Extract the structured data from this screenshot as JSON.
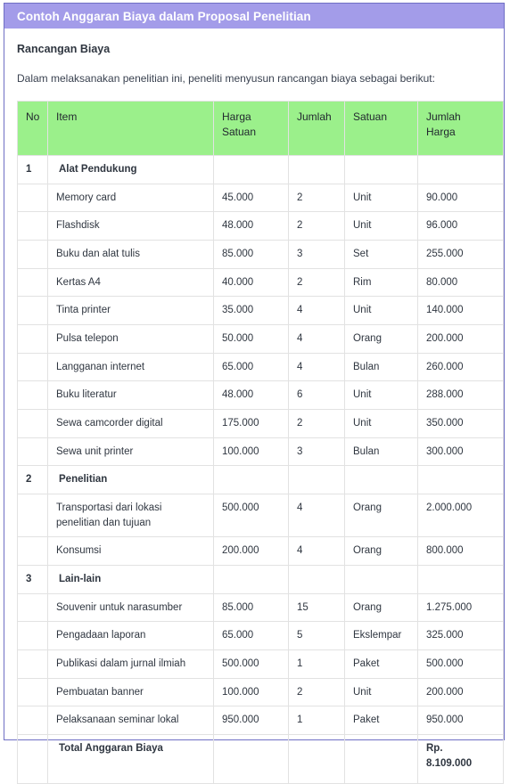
{
  "header": {
    "title": "Contoh Anggaran Biaya dalam Proposal Penelitian"
  },
  "document": {
    "section_heading": "Rancangan Biaya",
    "intro_paragraph": "Dalam melaksanakan penelitian ini, peneliti menyusun rancangan biaya sebagai berikut:"
  },
  "table": {
    "columns": [
      "No",
      "Item",
      "Harga Satuan",
      "Jumlah",
      "Satuan",
      "Jumlah Harga"
    ],
    "rows": [
      {
        "type": "group",
        "no": "1",
        "item": "Alat Pendukung",
        "harga": "",
        "jumlah": "",
        "satuan": "",
        "total": ""
      },
      {
        "type": "item",
        "no": "",
        "item": "Memory card",
        "harga": "45.000",
        "jumlah": "2",
        "satuan": "Unit",
        "total": "90.000"
      },
      {
        "type": "item",
        "no": "",
        "item": "Flashdisk",
        "harga": "48.000",
        "jumlah": "2",
        "satuan": "Unit",
        "total": "96.000"
      },
      {
        "type": "item",
        "no": "",
        "item": "Buku dan alat tulis",
        "harga": "85.000",
        "jumlah": "3",
        "satuan": "Set",
        "total": "255.000"
      },
      {
        "type": "item",
        "no": "",
        "item": "Kertas A4",
        "harga": "40.000",
        "jumlah": "2",
        "satuan": "Rim",
        "total": "80.000"
      },
      {
        "type": "item",
        "no": "",
        "item": "Tinta printer",
        "harga": "35.000",
        "jumlah": "4",
        "satuan": "Unit",
        "total": "140.000"
      },
      {
        "type": "item",
        "no": "",
        "item": "Pulsa telepon",
        "harga": "50.000",
        "jumlah": "4",
        "satuan": "Orang",
        "total": "200.000"
      },
      {
        "type": "item",
        "no": "",
        "item": "Langganan internet",
        "harga": "65.000",
        "jumlah": "4",
        "satuan": "Bulan",
        "total": "260.000"
      },
      {
        "type": "item",
        "no": "",
        "item": "Buku literatur",
        "harga": "48.000",
        "jumlah": "6",
        "satuan": "Unit",
        "total": "288.000"
      },
      {
        "type": "item",
        "no": "",
        "item": "Sewa camcorder digital",
        "harga": "175.000",
        "jumlah": "2",
        "satuan": "Unit",
        "total": "350.000"
      },
      {
        "type": "item",
        "no": "",
        "item": "Sewa unit printer",
        "harga": "100.000",
        "jumlah": "3",
        "satuan": "Bulan",
        "total": "300.000"
      },
      {
        "type": "group",
        "no": "2",
        "item": "Penelitian",
        "harga": "",
        "jumlah": "",
        "satuan": "",
        "total": ""
      },
      {
        "type": "item",
        "no": "",
        "item": "Transportasi dari lokasi penelitian dan tujuan",
        "harga": "500.000",
        "jumlah": "4",
        "satuan": "Orang",
        "total": "2.000.000"
      },
      {
        "type": "item",
        "no": "",
        "item": "Konsumsi",
        "harga": "200.000",
        "jumlah": "4",
        "satuan": "Orang",
        "total": "800.000"
      },
      {
        "type": "group",
        "no": "3",
        "item": "Lain-lain",
        "harga": "",
        "jumlah": "",
        "satuan": "",
        "total": ""
      },
      {
        "type": "item",
        "no": "",
        "item": "Souvenir untuk narasumber",
        "harga": "85.000",
        "jumlah": "15",
        "satuan": "Orang",
        "total": "1.275.000"
      },
      {
        "type": "item",
        "no": "",
        "item": "Pengadaan laporan",
        "harga": "65.000",
        "jumlah": "5",
        "satuan": "Ekslempar",
        "total": "325.000"
      },
      {
        "type": "item",
        "no": "",
        "item": "Publikasi dalam jurnal ilmiah",
        "harga": "500.000",
        "jumlah": "1",
        "satuan": "Paket",
        "total": "500.000"
      },
      {
        "type": "item",
        "no": "",
        "item": "Pembuatan banner",
        "harga": "100.000",
        "jumlah": "2",
        "satuan": "Unit",
        "total": "200.000"
      },
      {
        "type": "item",
        "no": "",
        "item": "Pelaksanaan seminar lokal",
        "harga": "950.000",
        "jumlah": "1",
        "satuan": "Paket",
        "total": "950.000"
      },
      {
        "type": "total",
        "no": "",
        "item": "Total Anggaran Biaya",
        "harga": "",
        "jumlah": "",
        "satuan": "",
        "total": "Rp. 8.109.000"
      }
    ]
  },
  "colors": {
    "header_bar": "#a39ce9",
    "table_header": "#9bf08b",
    "card_border": "#6f6fc4",
    "cell_border": "#e2e2e2",
    "text": "#2f3640"
  }
}
